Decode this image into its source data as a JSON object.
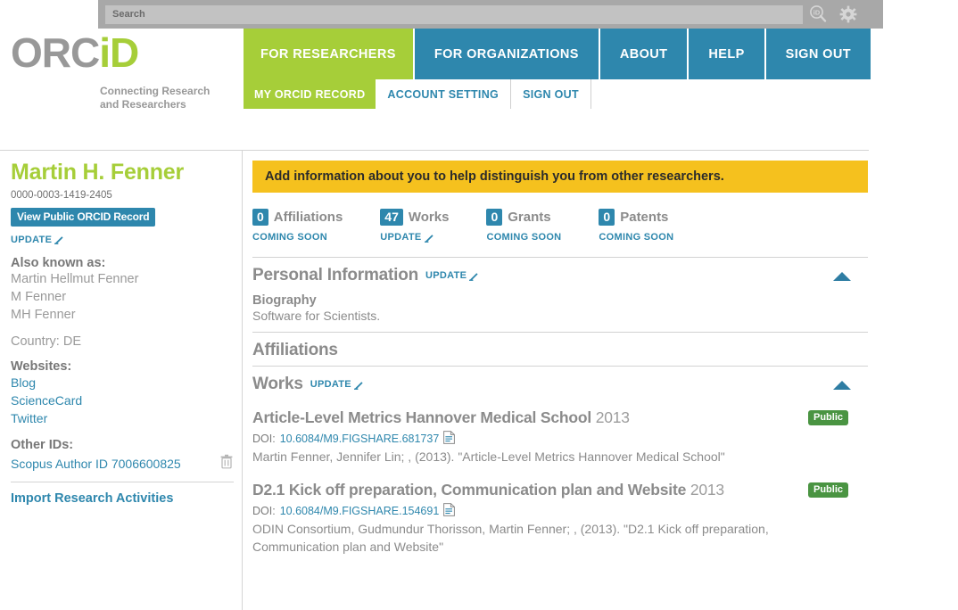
{
  "search": {
    "placeholder": "Search",
    "value": ""
  },
  "icons": {
    "orcid_search": "orcid-search-icon",
    "gear": "gear-icon"
  },
  "brand": {
    "logo_orc": "ORC",
    "logo_id": "iD",
    "tagline_line1": "Connecting Research",
    "tagline_line2": "and Researchers"
  },
  "colors": {
    "green": "#a6ce39",
    "blue": "#2e87ad",
    "yellow": "#f5c11e",
    "badge_green": "#4a9442",
    "gray_text": "#8b8b8b"
  },
  "mainnav": [
    {
      "label": "FOR RESEARCHERS",
      "active": true
    },
    {
      "label": "FOR ORGANIZATIONS",
      "active": false
    },
    {
      "label": "ABOUT",
      "active": false
    },
    {
      "label": "HELP",
      "active": false
    },
    {
      "label": "SIGN OUT",
      "active": false
    }
  ],
  "subnav": [
    {
      "label": "MY ORCID RECORD",
      "active": true
    },
    {
      "label": "ACCOUNT SETTING",
      "active": false
    },
    {
      "label": "SIGN OUT",
      "active": false
    }
  ],
  "sidebar": {
    "name": "Martin H. Fenner",
    "orcid_id": "0000-0003-1419-2405",
    "view_public_button": "View Public ORCID Record",
    "update_label": "UPDATE",
    "also_known_label": "Also known as:",
    "also_known_values": [
      "Martin Hellmut Fenner",
      "M Fenner",
      "MH Fenner"
    ],
    "country_label": "Country:",
    "country_value": "DE",
    "websites_label": "Websites:",
    "websites": [
      "Blog",
      "ScienceCard",
      "Twitter"
    ],
    "other_ids_label": "Other IDs:",
    "other_id_value": "Scopus Author ID 7006600825",
    "import_link": "Import Research Activities"
  },
  "main": {
    "banner": "Add information about you to help distinguish you from other researchers.",
    "stats": [
      {
        "count": "0",
        "name": "Affiliations",
        "sub": "COMING SOON",
        "sub_has_icon": false
      },
      {
        "count": "47",
        "name": "Works",
        "sub": "UPDATE",
        "sub_has_icon": true
      },
      {
        "count": "0",
        "name": "Grants",
        "sub": "COMING SOON",
        "sub_has_icon": false
      },
      {
        "count": "0",
        "name": "Patents",
        "sub": "COMING SOON",
        "sub_has_icon": false
      }
    ],
    "personal_information": {
      "title": "Personal Information",
      "update_label": "UPDATE",
      "biography_label": "Biography",
      "biography_text": "Software for Scientists."
    },
    "affiliations": {
      "title": "Affiliations"
    },
    "works": {
      "title": "Works",
      "update_label": "UPDATE",
      "doi_label": "DOI:",
      "items": [
        {
          "title": "Article-Level Metrics Hannover Medical School",
          "year": "2013",
          "doi": "10.6084/M9.FIGSHARE.681737",
          "citation": "Martin Fenner, Jennifer Lin; , (2013). \"Article-Level Metrics Hannover Medical School\"",
          "visibility": "Public"
        },
        {
          "title": "D2.1 Kick off preparation, Communication plan and Website",
          "year": "2013",
          "doi": "10.6084/M9.FIGSHARE.154691",
          "citation": "ODIN Consortium, Gudmundur Thorisson, Martin Fenner; , (2013). \"D2.1 Kick off preparation, Communication plan and Website\"",
          "visibility": "Public"
        }
      ]
    }
  }
}
